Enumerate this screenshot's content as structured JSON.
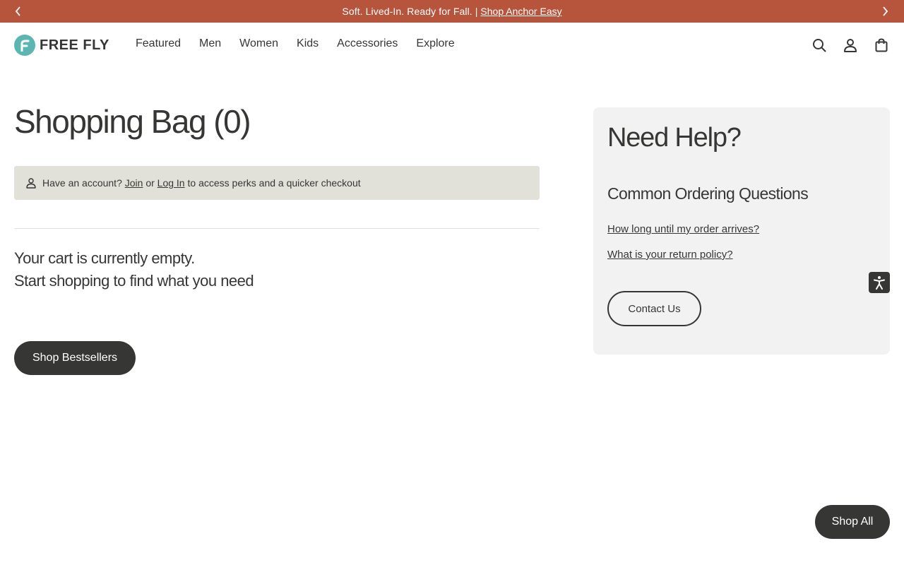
{
  "announcement": {
    "message": "Soft. Lived-In. Ready for Fall.",
    "separator": "|",
    "link_text": "Shop Anchor Easy",
    "prev_icon": "chevron-left-icon",
    "next_icon": "chevron-right-icon"
  },
  "header": {
    "logo_text": "FREE FLY",
    "nav": [
      "Featured",
      "Men",
      "Women",
      "Kids",
      "Accessories",
      "Explore"
    ],
    "icons": [
      "search-icon",
      "account-icon",
      "bag-icon"
    ]
  },
  "cart": {
    "title": "Shopping Bag (0)",
    "account_prefix": "Have an account?",
    "join_label": "Join",
    "or_text": "or",
    "login_label": "Log In",
    "account_suffix": "to access perks and a quicker checkout",
    "empty_line1": "Your cart is currently empty.",
    "empty_line2": "Start shopping to find what you need",
    "shop_bestsellers_label": "Shop Bestsellers"
  },
  "help": {
    "title": "Need Help?",
    "subtitle": "Common Ordering Questions",
    "questions": [
      "How long until my order arrives?",
      "What is your return policy?"
    ],
    "contact_label": "Contact Us"
  },
  "floating": {
    "accessibility_icon": "accessibility-icon",
    "shop_all_label": "Shop All"
  },
  "colors": {
    "announcement_bg": "#b6543c",
    "brand_teal": "#5bb6b2",
    "text_dark": "#363735",
    "account_box_bg": "#e1e0d9",
    "help_panel_bg": "#f2f2f2"
  }
}
